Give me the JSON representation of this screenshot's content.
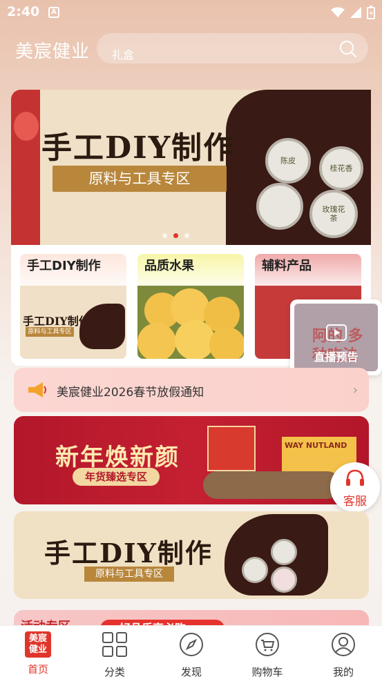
{
  "status_bar": {
    "time": "2:40",
    "indicator": "A"
  },
  "header": {
    "logo_text": "美宸健业",
    "search_text": "礼盒"
  },
  "banner": {
    "title": "手工DIY制作",
    "subtitle": "原料与工具专区",
    "tins": [
      "桂花香",
      "玫瑰花茶",
      "陈皮"
    ],
    "dots": 3,
    "active_dot": 2
  },
  "categories": [
    {
      "title": "手工DIY制作",
      "thumb_title": "手工DIY制作",
      "thumb_subtitle": "原料与工具专区"
    },
    {
      "title": "品质水果"
    },
    {
      "title": "辅料产品"
    }
  ],
  "live": {
    "label": "直播预告",
    "overlay_text": "阿的 多种吃法"
  },
  "notice": {
    "text": "美宸健业2026春节放假通知",
    "icon": "megaphone-icon"
  },
  "promo_red": {
    "title": "新年焕新颜",
    "tag": "年货臻选专区",
    "box_text": "WAY NUTLAND"
  },
  "promo_beige": {
    "title": "手工DIY制作",
    "tag": "原料与工具专区"
  },
  "promo_partial": {
    "label": "活动专区",
    "pill": "好品乐享必购"
  },
  "service": {
    "label": "客服",
    "icon": "headset-icon"
  },
  "bottom_nav": [
    {
      "label": "首页",
      "icon": "home-logo-icon",
      "icon_text": "美宸健业",
      "active": true
    },
    {
      "label": "分类",
      "icon": "grid-icon"
    },
    {
      "label": "发现",
      "icon": "compass-icon"
    },
    {
      "label": "购物车",
      "icon": "cart-icon"
    },
    {
      "label": "我的",
      "icon": "user-icon"
    }
  ],
  "colors": {
    "accent": "#e0352b",
    "gold": "#b8873c",
    "header_bg": "#e9c2ad"
  }
}
